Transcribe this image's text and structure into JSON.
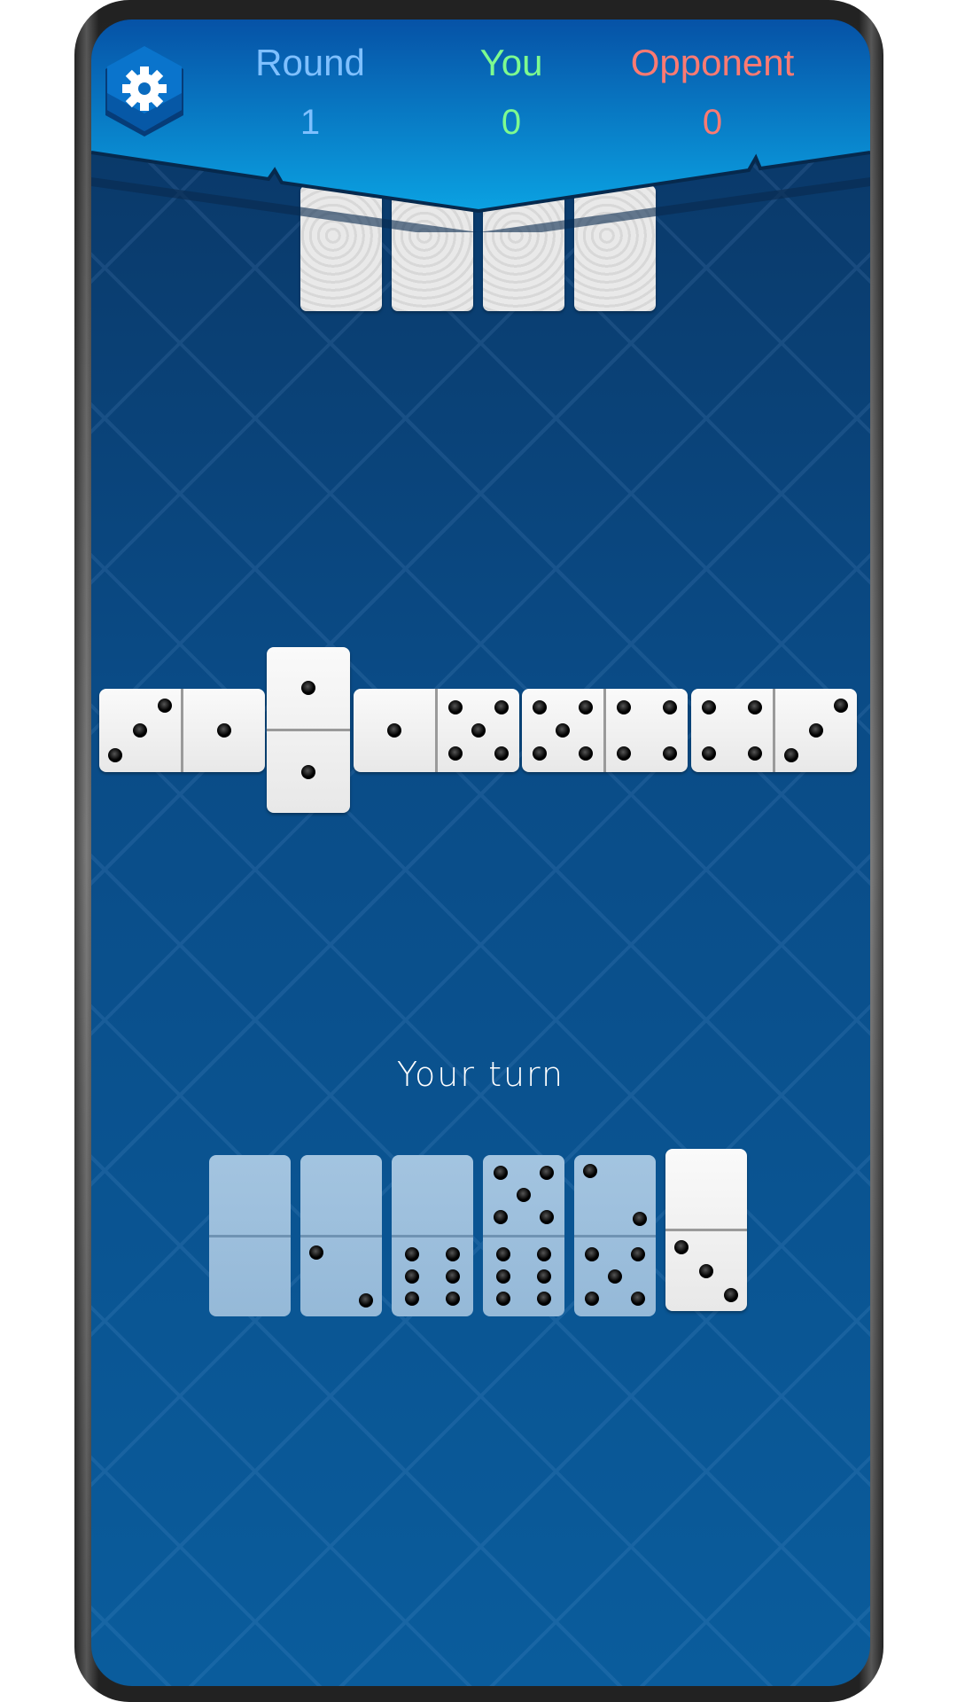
{
  "header": {
    "round": {
      "label": "Round",
      "value": "1",
      "color": "#7fc0ff"
    },
    "you": {
      "label": "You",
      "value": "0",
      "color": "#7dfb8f"
    },
    "opponent": {
      "label": "Opponent",
      "value": "0",
      "color": "#ff7a72"
    },
    "settings_icon": "gear-icon"
  },
  "opponent_hand": {
    "count": 4
  },
  "board": {
    "tiles": [
      {
        "values": [
          3,
          1
        ],
        "orientation": "horizontal"
      },
      {
        "values": [
          1,
          1
        ],
        "orientation": "vertical"
      },
      {
        "values": [
          1,
          5
        ],
        "orientation": "horizontal"
      },
      {
        "values": [
          5,
          4
        ],
        "orientation": "horizontal"
      },
      {
        "values": [
          4,
          3
        ],
        "orientation": "horizontal"
      }
    ]
  },
  "status": {
    "text": "Your turn"
  },
  "player_hand": {
    "tiles": [
      {
        "values": [
          0,
          0
        ],
        "playable": false
      },
      {
        "values": [
          0,
          2
        ],
        "playable": false
      },
      {
        "values": [
          0,
          6
        ],
        "playable": false
      },
      {
        "values": [
          5,
          6
        ],
        "playable": false
      },
      {
        "values": [
          2,
          5
        ],
        "playable": false
      },
      {
        "values": [
          0,
          3
        ],
        "playable": true
      }
    ]
  }
}
